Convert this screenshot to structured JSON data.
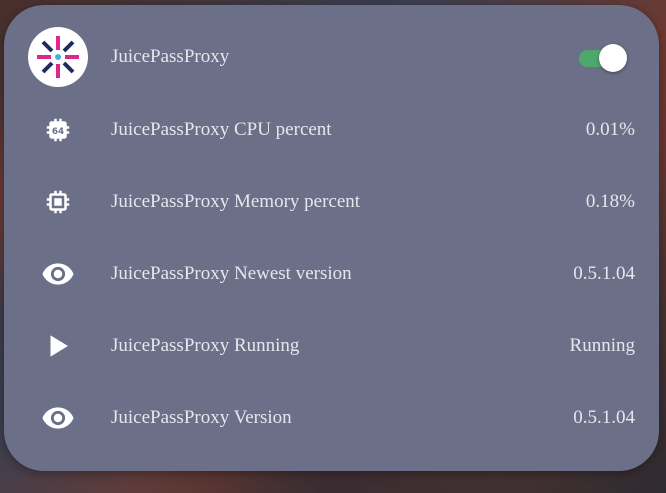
{
  "entity": {
    "name": "JuicePassProxy",
    "icon": "juicepass-logo",
    "toggle_state": "on",
    "toggle_color": "#4ea86b"
  },
  "rows": [
    {
      "icon": "cpu-64bit-icon",
      "label": "JuicePassProxy CPU percent",
      "value": "0.01%"
    },
    {
      "icon": "memory-chip-icon",
      "label": "JuicePassProxy Memory percent",
      "value": "0.18%"
    },
    {
      "icon": "eye-icon",
      "label": "JuicePassProxy Newest version",
      "value": "0.5.1.04"
    },
    {
      "icon": "play-icon",
      "label": "JuicePassProxy Running",
      "value": "Running"
    },
    {
      "icon": "eye-icon",
      "label": "JuicePassProxy Version",
      "value": "0.5.1.04"
    }
  ],
  "colors": {
    "card_background": "#6b6f87",
    "text": "#e6e7ee"
  }
}
